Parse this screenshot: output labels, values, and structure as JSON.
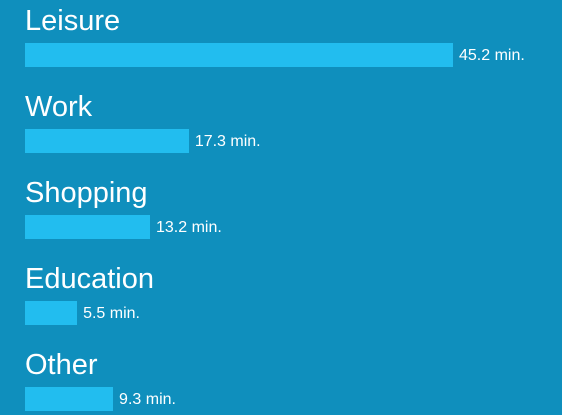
{
  "chart_data": {
    "type": "bar",
    "orientation": "horizontal",
    "categories": [
      "Leisure",
      "Work",
      "Shopping",
      "Education",
      "Other"
    ],
    "values": [
      45.2,
      17.3,
      13.2,
      5.5,
      9.3
    ],
    "value_labels": [
      "45.2 min.",
      "17.3 min.",
      "13.2 min.",
      "5.5 min.",
      "9.3 min."
    ],
    "title": "",
    "xlabel": "",
    "ylabel": "",
    "grid": false,
    "legend": "none",
    "colors": {
      "background": "#0f8fbd",
      "bar": "#22bdef",
      "text": "#ffffff"
    }
  }
}
